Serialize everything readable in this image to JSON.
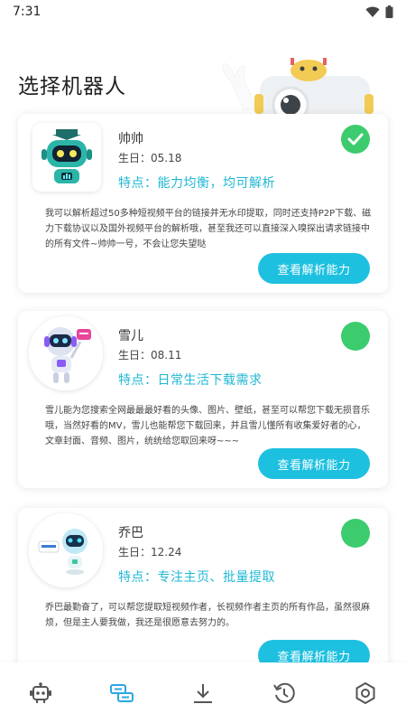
{
  "status_bar": {
    "time": "7:31"
  },
  "page": {
    "title": "选择机器人"
  },
  "bots": [
    {
      "name": "帅帅",
      "birthday": "生日：05.18",
      "feature": "特点：能力均衡，均可解析",
      "description": "我可以解析超过50多种短视频平台的链接并无水印提取，同时还支持P2P下载、磁力下载协议以及国外视频平台的解析哦，甚至我还可以直接深入嗅探出请求链接中的所有文件~帅帅一号，不会让您失望哒",
      "button_label": "查看解析能力",
      "selected": true
    },
    {
      "name": "雪儿",
      "birthday": "生日：08.11",
      "feature": "特点：日常生活下载需求",
      "description": "雪儿能为您搜索全网最最最好看的头像、图片、壁纸，甚至可以帮您下载无损音乐哦，当然好看的MV，雪儿也能帮您下载回来，并且雪儿懂所有收集爱好者的心，文章封面、音频、图片，统统给您取回来呀~~~",
      "button_label": "查看解析能力",
      "selected": false
    },
    {
      "name": "乔巴",
      "birthday": "生日：12.24",
      "feature": "特点：专注主页、批量提取",
      "description": "乔巴最勤奋了，可以帮您提取短视频作者，长视频作者主页的所有作品，虽然很麻烦，但是主人要我做，我还是很愿意去努力的。",
      "button_label": "查看解析能力",
      "selected": false
    }
  ],
  "nav": {
    "items": [
      "robot-icon",
      "parse-icon",
      "download-icon",
      "history-icon",
      "settings-icon"
    ],
    "active_index": 1
  },
  "colors": {
    "accent": "#1ec0e0",
    "feature_text": "#1fb8d4",
    "selected": "#3ccc6e",
    "nav_active": "#2aa7e0"
  }
}
